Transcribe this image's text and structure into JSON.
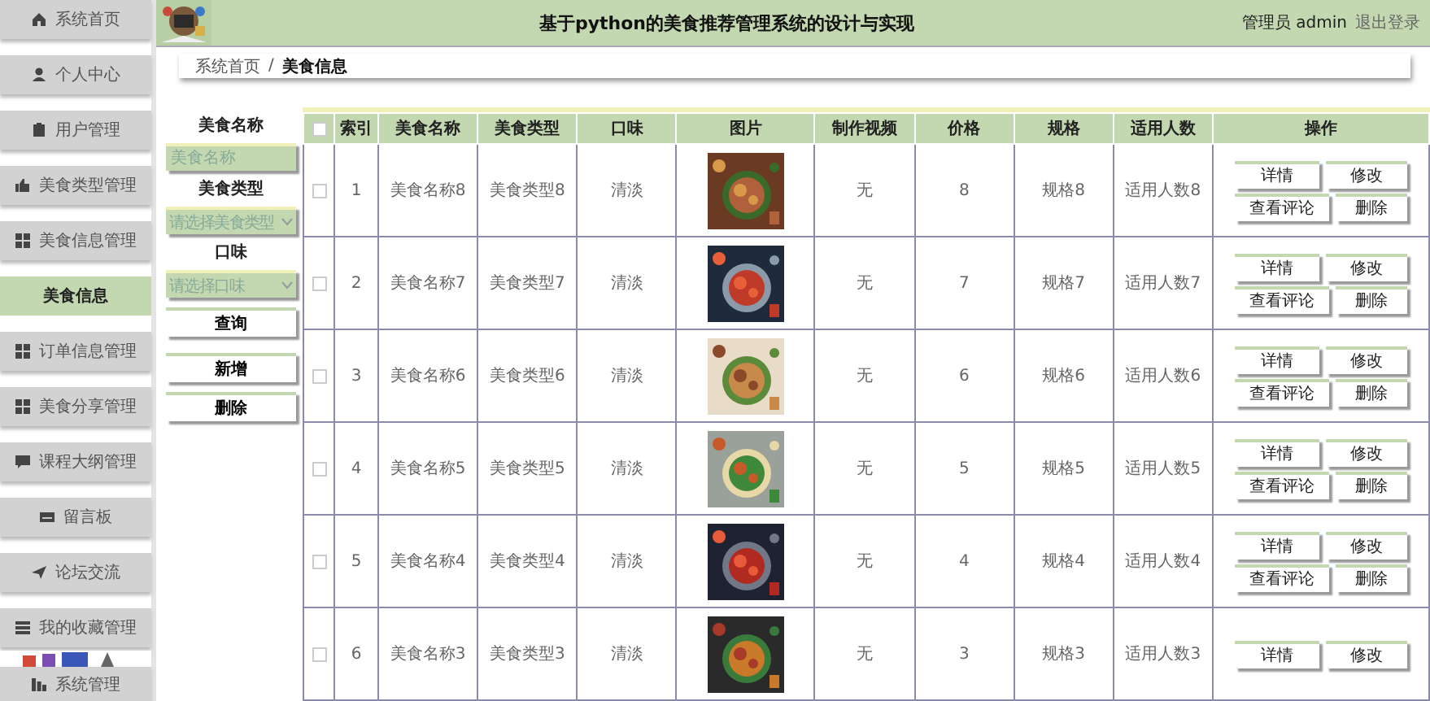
{
  "sidebar": {
    "items": [
      {
        "label": "系统首页",
        "kind": "menu",
        "selected": false
      },
      {
        "label": "个人中心",
        "kind": "menu",
        "selected": false
      },
      {
        "label": "用户管理",
        "kind": "menu",
        "selected": false
      },
      {
        "label": "美食类型管理",
        "kind": "menu",
        "selected": false
      },
      {
        "label": "美食信息管理",
        "kind": "menu",
        "selected": false
      },
      {
        "label": "美食信息",
        "kind": "submenu",
        "selected": true
      },
      {
        "label": "订单信息管理",
        "kind": "menu",
        "selected": false
      },
      {
        "label": "美食分享管理",
        "kind": "menu",
        "selected": false
      },
      {
        "label": "课程大纲管理",
        "kind": "menu",
        "selected": false
      },
      {
        "label": "留言板",
        "kind": "menu",
        "selected": false
      },
      {
        "label": "论坛交流",
        "kind": "menu",
        "selected": false
      },
      {
        "label": "我的收藏管理",
        "kind": "menu",
        "selected": false
      },
      {
        "label": "系统管理",
        "kind": "menu",
        "selected": false
      }
    ]
  },
  "header": {
    "title": "基于python的美食推荐管理系统的设计与实现",
    "user": "管理员 admin",
    "logout": "退出登录"
  },
  "breadcrumb": [
    "系统首页",
    "/",
    "美食信息"
  ],
  "filters": [
    {
      "kind": "input",
      "label": "美食名称",
      "placeholder": "美食名称"
    },
    {
      "kind": "select",
      "label": "美食类型",
      "placeholder": "请选择美食类型"
    },
    {
      "kind": "select",
      "label": "口味",
      "placeholder": "请选择口味"
    }
  ],
  "filter_buttons": [
    "查询",
    "新增",
    "删除"
  ],
  "table": {
    "all_checked": false,
    "columns": [
      {
        "kind": "text",
        "label": "索引"
      },
      {
        "kind": "text",
        "label": "美食名称"
      },
      {
        "kind": "text",
        "label": "美食类型"
      },
      {
        "kind": "text",
        "label": "口味"
      },
      {
        "label": "图片"
      },
      {
        "kind": "text",
        "label": "制作视频"
      },
      {
        "kind": "text",
        "label": "价格"
      },
      {
        "kind": "text",
        "label": "规格"
      },
      {
        "kind": "text",
        "label": "适用人数"
      },
      {
        "kind": "actions",
        "label": "操作"
      }
    ],
    "rows": [
      {
        "checked": false,
        "cells": [
          "1",
          "美食名称8",
          "美食类型8",
          "清淡",
          "",
          "无",
          "8",
          "规格8",
          "适用人数8"
        ],
        "actions": [
          "详情",
          "修改",
          "查看评论",
          "删除"
        ]
      },
      {
        "checked": false,
        "cells": [
          "2",
          "美食名称7",
          "美食类型7",
          "清淡",
          "",
          "无",
          "7",
          "规格7",
          "适用人数7"
        ],
        "actions": [
          "详情",
          "修改",
          "查看评论",
          "删除"
        ]
      },
      {
        "checked": false,
        "cells": [
          "3",
          "美食名称6",
          "美食类型6",
          "清淡",
          "",
          "无",
          "6",
          "规格6",
          "适用人数6"
        ],
        "actions": [
          "详情",
          "修改",
          "查看评论",
          "删除"
        ]
      },
      {
        "checked": false,
        "cells": [
          "4",
          "美食名称5",
          "美食类型5",
          "清淡",
          "",
          "无",
          "5",
          "规格5",
          "适用人数5"
        ],
        "actions": [
          "详情",
          "修改",
          "查看评论",
          "删除"
        ]
      },
      {
        "checked": false,
        "cells": [
          "5",
          "美食名称4",
          "美食类型4",
          "清淡",
          "",
          "无",
          "4",
          "规格4",
          "适用人数4"
        ],
        "actions": [
          "详情",
          "修改",
          "查看评论",
          "删除"
        ]
      },
      {
        "checked": false,
        "cells": [
          "6",
          "美食名称3",
          "美食类型3",
          "清淡",
          "",
          "无",
          "3",
          "规格3",
          "适用人数3"
        ],
        "actions": [
          "详情",
          "修改"
        ]
      }
    ]
  }
}
